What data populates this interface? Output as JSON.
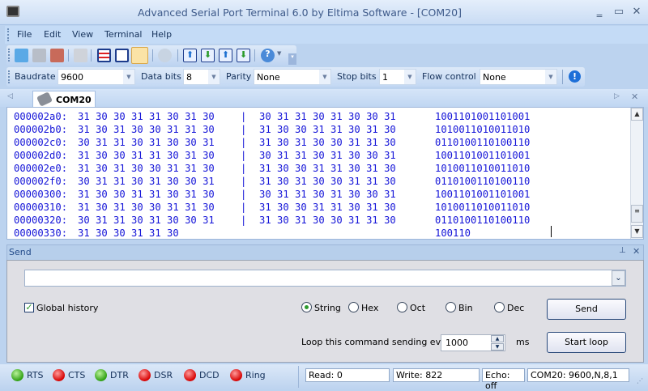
{
  "window": {
    "title": "Advanced Serial Port Terminal 6.0 by Eltima Software - [COM20]"
  },
  "menu": [
    "File",
    "Edit",
    "View",
    "Terminal",
    "Help"
  ],
  "toolbar_icons": [
    "new-session-icon",
    "connect-icon",
    "disconnect-icon",
    "copy-icon",
    "text-view-icon",
    "vt100-view-icon",
    "hex-view-icon",
    "clear-icon",
    "send-file-icon",
    "receive-file-icon",
    "send-binary-icon",
    "receive-binary-icon",
    "help-icon"
  ],
  "params": {
    "baudrate_label": "Baudrate",
    "baudrate": "9600",
    "databits_label": "Data bits",
    "databits": "8",
    "parity_label": "Parity",
    "parity": "None",
    "stopbits_label": "Stop bits",
    "stopbits": "1",
    "flow_label": "Flow control",
    "flow": "None"
  },
  "tab": {
    "label": "COM20"
  },
  "terminal": {
    "rows": [
      {
        "addr": "000002a0:",
        "hex1": "31 30 30 31 31 30 31 30",
        "sep": "|",
        "hex2": "30 31 31 30 31 30 30 31",
        "ascii": "1001101001101001"
      },
      {
        "addr": "000002b0:",
        "hex1": "31 30 31 30 30 31 31 30",
        "sep": "|",
        "hex2": "31 30 30 31 31 30 31 30",
        "ascii": "1010011010011010"
      },
      {
        "addr": "000002c0:",
        "hex1": "30 31 31 30 31 30 30 31",
        "sep": "|",
        "hex2": "31 30 31 30 30 31 31 30",
        "ascii": "0110100110100110"
      },
      {
        "addr": "000002d0:",
        "hex1": "31 30 30 31 31 30 31 30",
        "sep": "|",
        "hex2": "30 31 31 30 31 30 30 31",
        "ascii": "1001101001101001"
      },
      {
        "addr": "000002e0:",
        "hex1": "31 30 31 30 30 31 31 30",
        "sep": "|",
        "hex2": "31 30 30 31 31 30 31 30",
        "ascii": "1010011010011010"
      },
      {
        "addr": "000002f0:",
        "hex1": "30 31 31 30 31 30 30 31",
        "sep": "|",
        "hex2": "31 30 31 30 30 31 31 30",
        "ascii": "0110100110100110"
      },
      {
        "addr": "00000300:",
        "hex1": "31 30 30 31 31 30 31 30",
        "sep": "|",
        "hex2": "30 31 31 30 31 30 30 31",
        "ascii": "1001101001101001"
      },
      {
        "addr": "00000310:",
        "hex1": "31 30 31 30 30 31 31 30",
        "sep": "|",
        "hex2": "31 30 30 31 31 30 31 30",
        "ascii": "1010011010011010"
      },
      {
        "addr": "00000320:",
        "hex1": "30 31 31 30 31 30 30 31",
        "sep": "|",
        "hex2": "31 30 31 30 30 31 31 30",
        "ascii": "0110100110100110"
      },
      {
        "addr": "00000330:",
        "hex1": "31 30 30 31 31 30",
        "sep": "",
        "hex2": "",
        "ascii": "100110"
      }
    ]
  },
  "send": {
    "title": "Send",
    "input": "",
    "global_history": "Global history",
    "global_history_checked": true,
    "formats": [
      {
        "label": "String",
        "selected": true
      },
      {
        "label": "Hex",
        "selected": false
      },
      {
        "label": "Oct",
        "selected": false
      },
      {
        "label": "Bin",
        "selected": false
      },
      {
        "label": "Dec",
        "selected": false
      }
    ],
    "send_button": "Send",
    "loop_label": "Loop this command sending every",
    "loop_value": "1000",
    "loop_unit": "ms",
    "start_loop_button": "Start loop"
  },
  "signals": [
    {
      "label": "RTS",
      "state": "on"
    },
    {
      "label": "CTS",
      "state": "off"
    },
    {
      "label": "DTR",
      "state": "on"
    },
    {
      "label": "DSR",
      "state": "off"
    },
    {
      "label": "DCD",
      "state": "off"
    },
    {
      "label": "Ring",
      "state": "off"
    }
  ],
  "status": {
    "read": "Read:  0",
    "write": "Write:  822",
    "echo": "Echo: off",
    "port": "COM20: 9600,N,8,1"
  },
  "colors": {
    "terminal_text": "#1414d8",
    "led_on": "#2f9f12",
    "led_off": "#d60000"
  }
}
